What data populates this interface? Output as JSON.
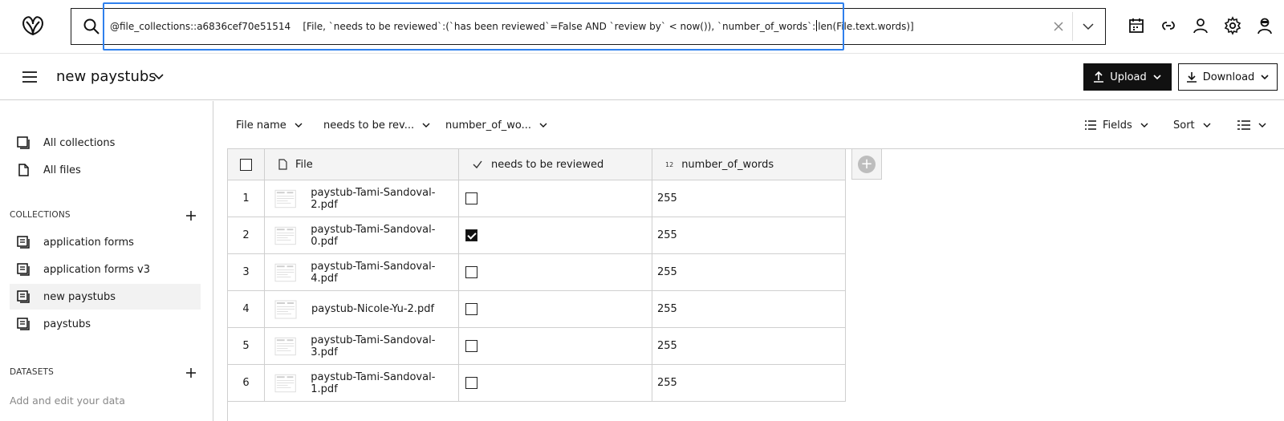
{
  "search": {
    "query_before_caret": "@file_collections::a6836cef70e51514    [File, `needs to be reviewed`:(`has been reviewed`=False AND `review by` < now()), `number_of_words`:",
    "query_after_caret": "len(File.text.words)]"
  },
  "header": {
    "title": "new paystubs",
    "upload_label": "Upload",
    "download_label": "Download"
  },
  "sidebar": {
    "all_collections": "All collections",
    "all_files": "All files",
    "collections_heading": "COLLECTIONS",
    "collections": [
      "application forms",
      "application forms v3",
      "new paystubs",
      "paystubs"
    ],
    "active_collection": "new paystubs",
    "datasets_heading": "DATASETS",
    "datasets_hint": "Add and edit your data"
  },
  "filters": {
    "file_name": "File name",
    "needs_review": "needs to be rev...",
    "number_of_words": "number_of_wo...",
    "fields": "Fields",
    "sort": "Sort"
  },
  "table": {
    "columns": {
      "file": "File",
      "needs_review": "needs to be reviewed",
      "num_type": "12",
      "number_of_words": "number_of_words"
    },
    "rows": [
      {
        "idx": "1",
        "file": "paystub-Tami-Sandoval-2.pdf",
        "checked": false,
        "words": "255"
      },
      {
        "idx": "2",
        "file": "paystub-Tami-Sandoval-0.pdf",
        "checked": true,
        "words": "255"
      },
      {
        "idx": "3",
        "file": "paystub-Tami-Sandoval-4.pdf",
        "checked": false,
        "words": "255"
      },
      {
        "idx": "4",
        "file": "paystub-Nicole-Yu-2.pdf",
        "checked": false,
        "words": "255"
      },
      {
        "idx": "5",
        "file": "paystub-Tami-Sandoval-3.pdf",
        "checked": false,
        "words": "255"
      },
      {
        "idx": "6",
        "file": "paystub-Tami-Sandoval-1.pdf",
        "checked": false,
        "words": "255"
      }
    ]
  },
  "colors": {
    "focus": "#2f80ed",
    "primary_button": "#111111",
    "active_row": "#f2f2f2"
  }
}
